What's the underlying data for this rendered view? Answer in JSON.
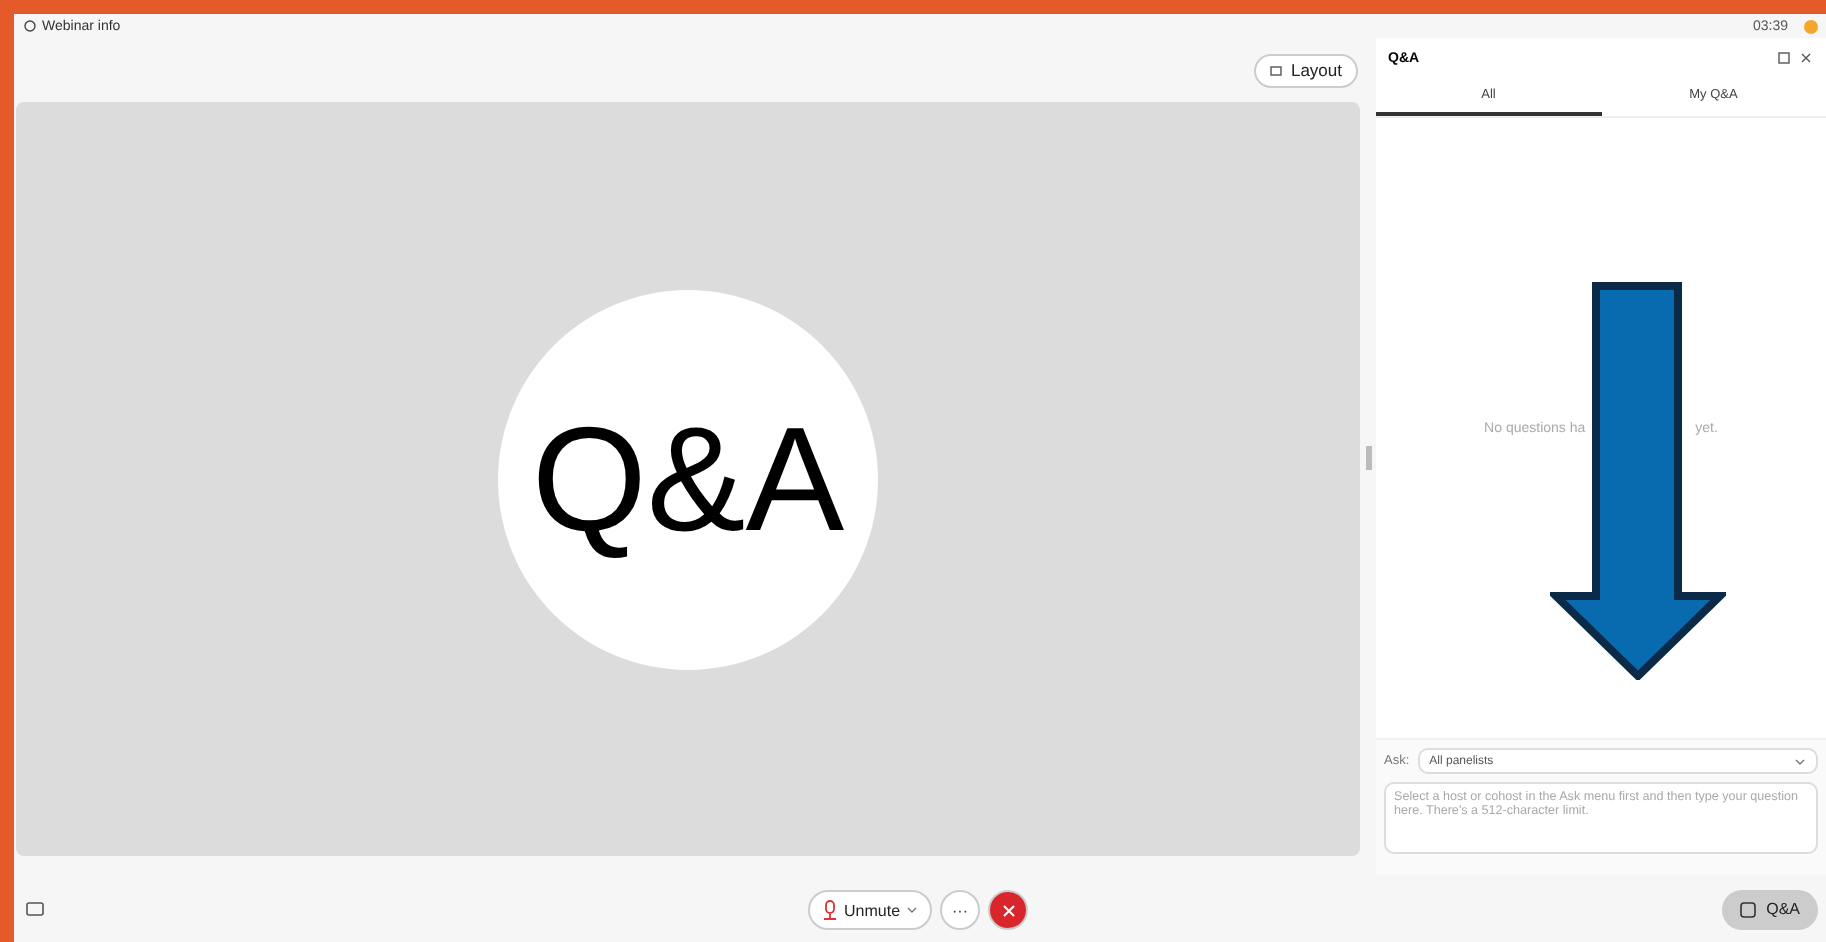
{
  "top_bar": {
    "title": "Webinar info",
    "time": "03:39"
  },
  "stage": {
    "layout_button": "Layout",
    "slide_text": "Q&A"
  },
  "qa_panel": {
    "title": "Q&A",
    "tabs": [
      {
        "label": "All",
        "selected": true
      },
      {
        "label": "My Q&A",
        "selected": false
      }
    ],
    "empty_message": [
      "No questions ha",
      "yet."
    ],
    "ask_label": "Ask:",
    "ask_select": "All panelists",
    "question_placeholder": "Select a host or cohost in the Ask menu first and then type your question here. There's a 512-character limit."
  },
  "controls": {
    "unmute": "Unmute",
    "more": "···",
    "qa_button": "Q&A"
  }
}
